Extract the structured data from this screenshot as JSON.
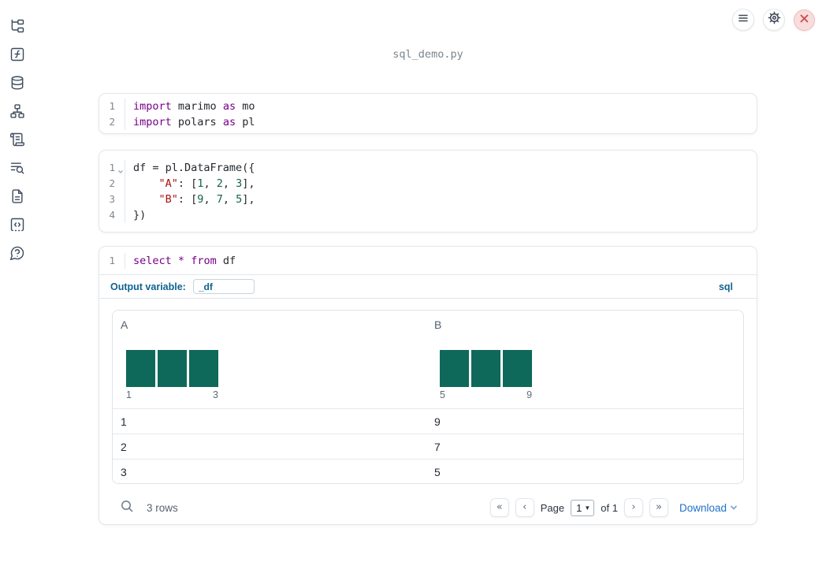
{
  "window": {
    "title": "sql_demo.py"
  },
  "toolbar": {
    "buttons": [
      {
        "name": "menu",
        "icon": "hamburger-icon"
      },
      {
        "name": "settings",
        "icon": "gear-icon"
      },
      {
        "name": "shutdown",
        "icon": "close-icon"
      }
    ]
  },
  "sidebar": {
    "items": [
      {
        "icon": "file-explorer-icon"
      },
      {
        "icon": "function-square-icon"
      },
      {
        "icon": "datasources-icon"
      },
      {
        "icon": "dependency-graph-icon"
      },
      {
        "icon": "scroll-logs-icon"
      },
      {
        "icon": "list-search-icon"
      },
      {
        "icon": "documentation-icon"
      },
      {
        "icon": "snippets-icon"
      },
      {
        "icon": "help-icon"
      }
    ]
  },
  "colors": {
    "keyword": "#770088",
    "string": "#aa1111",
    "number": "#116644",
    "histogram_bar": "#0e695a",
    "accent_blue": "#0f6391",
    "link_blue": "#2272c8",
    "close_button_bg": "#f9dcdc",
    "close_button_x": "#c84b4b"
  },
  "cells": [
    {
      "kind": "python",
      "lines": [
        {
          "n": "1",
          "toks": [
            [
              "kw",
              "import"
            ],
            [
              "pl",
              " marimo "
            ],
            [
              "kw",
              "as"
            ],
            [
              "pl",
              " mo"
            ]
          ]
        },
        {
          "n": "2",
          "toks": [
            [
              "kw",
              "import"
            ],
            [
              "pl",
              " polars "
            ],
            [
              "kw",
              "as"
            ],
            [
              "pl",
              " pl"
            ]
          ]
        }
      ]
    },
    {
      "kind": "python",
      "lines": [
        {
          "n": "1",
          "fold": true,
          "toks": [
            [
              "pl",
              "df = pl.DataFrame({"
            ]
          ]
        },
        {
          "n": "2",
          "toks": [
            [
              "pl",
              "    "
            ],
            [
              "str",
              "\"A\""
            ],
            [
              "pl",
              ": ["
            ],
            [
              "num",
              "1"
            ],
            [
              "pl",
              ", "
            ],
            [
              "num",
              "2"
            ],
            [
              "pl",
              ", "
            ],
            [
              "num",
              "3"
            ],
            [
              "pl",
              "],"
            ]
          ]
        },
        {
          "n": "3",
          "toks": [
            [
              "pl",
              "    "
            ],
            [
              "str",
              "\"B\""
            ],
            [
              "pl",
              ": ["
            ],
            [
              "num",
              "9"
            ],
            [
              "pl",
              ", "
            ],
            [
              "num",
              "7"
            ],
            [
              "pl",
              ", "
            ],
            [
              "num",
              "5"
            ],
            [
              "pl",
              "],"
            ]
          ]
        },
        {
          "n": "4",
          "toks": [
            [
              "pl",
              "})"
            ]
          ]
        }
      ]
    },
    {
      "kind": "sql",
      "lines": [
        {
          "n": "1",
          "toks": [
            [
              "kw",
              "select"
            ],
            [
              "pl",
              " "
            ],
            [
              "kw",
              "*"
            ],
            [
              "pl",
              " "
            ],
            [
              "kw",
              "from"
            ],
            [
              "pl",
              " df"
            ]
          ]
        }
      ]
    }
  ],
  "sql_cell": {
    "output_variable_label": "Output variable:",
    "output_variable_value": "_df",
    "language_label": "sql"
  },
  "table": {
    "columns": [
      {
        "header": "A",
        "histogram": {
          "bar_count": 3,
          "bar_values": [
            1,
            1,
            1
          ],
          "min_label": "1",
          "max_label": "3"
        }
      },
      {
        "header": "B",
        "histogram": {
          "bar_count": 3,
          "bar_values": [
            1,
            1,
            1
          ],
          "min_label": "5",
          "max_label": "9"
        }
      }
    ],
    "rows": [
      [
        "1",
        "9"
      ],
      [
        "2",
        "7"
      ],
      [
        "3",
        "5"
      ]
    ],
    "footer": {
      "row_count": "3 rows",
      "page_label": "Page",
      "page_value": "1",
      "of_label": "of 1",
      "download_label": "Download"
    }
  }
}
